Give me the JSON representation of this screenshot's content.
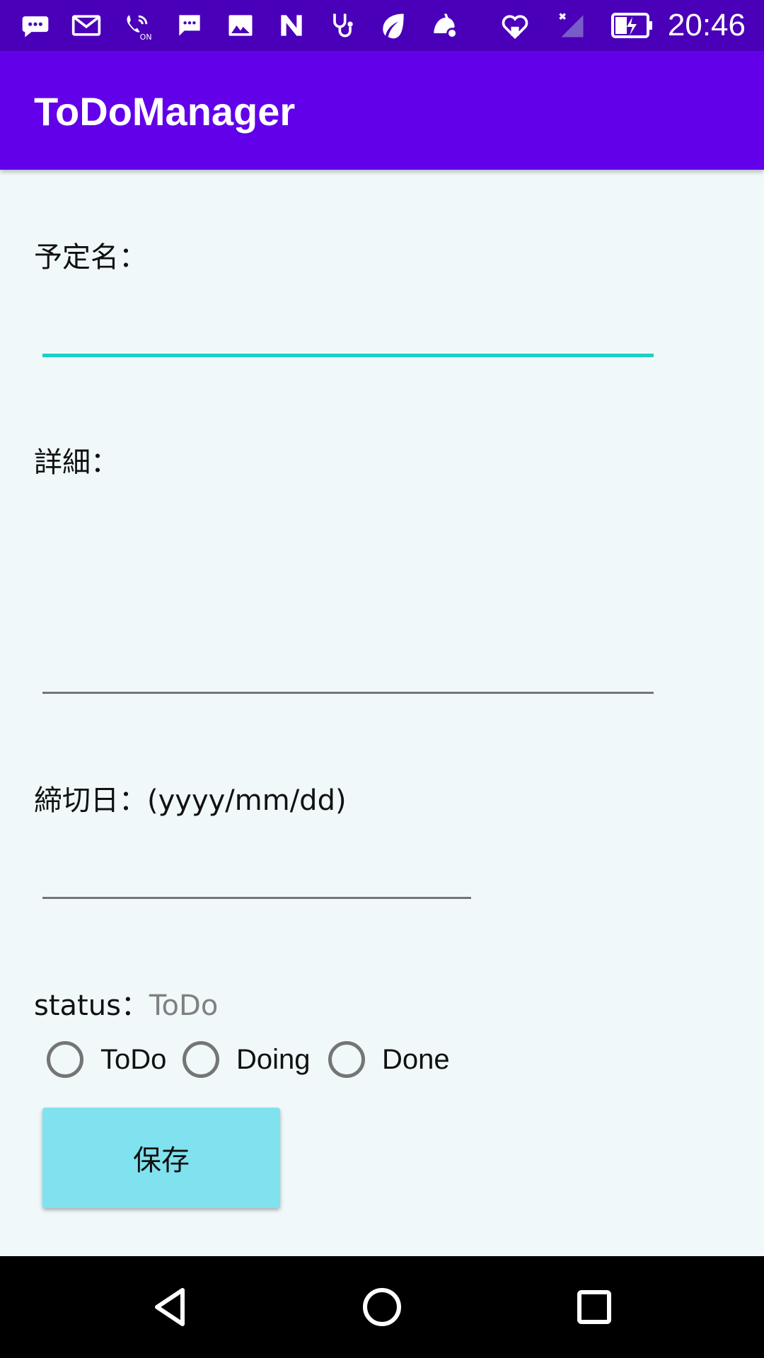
{
  "status_bar": {
    "time": "20:46",
    "icons": [
      "chat-bubble-icon",
      "gmail-icon",
      "wifi-calling-icon",
      "sms-icon",
      "gallery-icon",
      "n-logo-icon",
      "stethoscope-icon",
      "leaf-icon",
      "android-settings-icon",
      "heart-shield-icon",
      "no-signal-icon",
      "battery-charging-icon"
    ]
  },
  "app_bar": {
    "title": "ToDoManager"
  },
  "form": {
    "title_label": "予定名：",
    "title_value": "",
    "detail_label": "詳細：",
    "detail_value": "",
    "due_label": "締切日：(yyyy/mm/dd)",
    "due_value": "",
    "status_label": "status：",
    "status_value": "ToDo",
    "radio_options": [
      "ToDo",
      "Doing",
      "Done"
    ],
    "save_label": "保存"
  },
  "colors": {
    "status_bar": "#4a00b8",
    "app_bar": "#6200ea",
    "focus_accent": "#1ccfc4",
    "save_button": "#80e2ef",
    "background": "#f0f8fa"
  },
  "nav_bar": {
    "icons": [
      "back-icon",
      "home-icon",
      "recents-icon"
    ]
  }
}
